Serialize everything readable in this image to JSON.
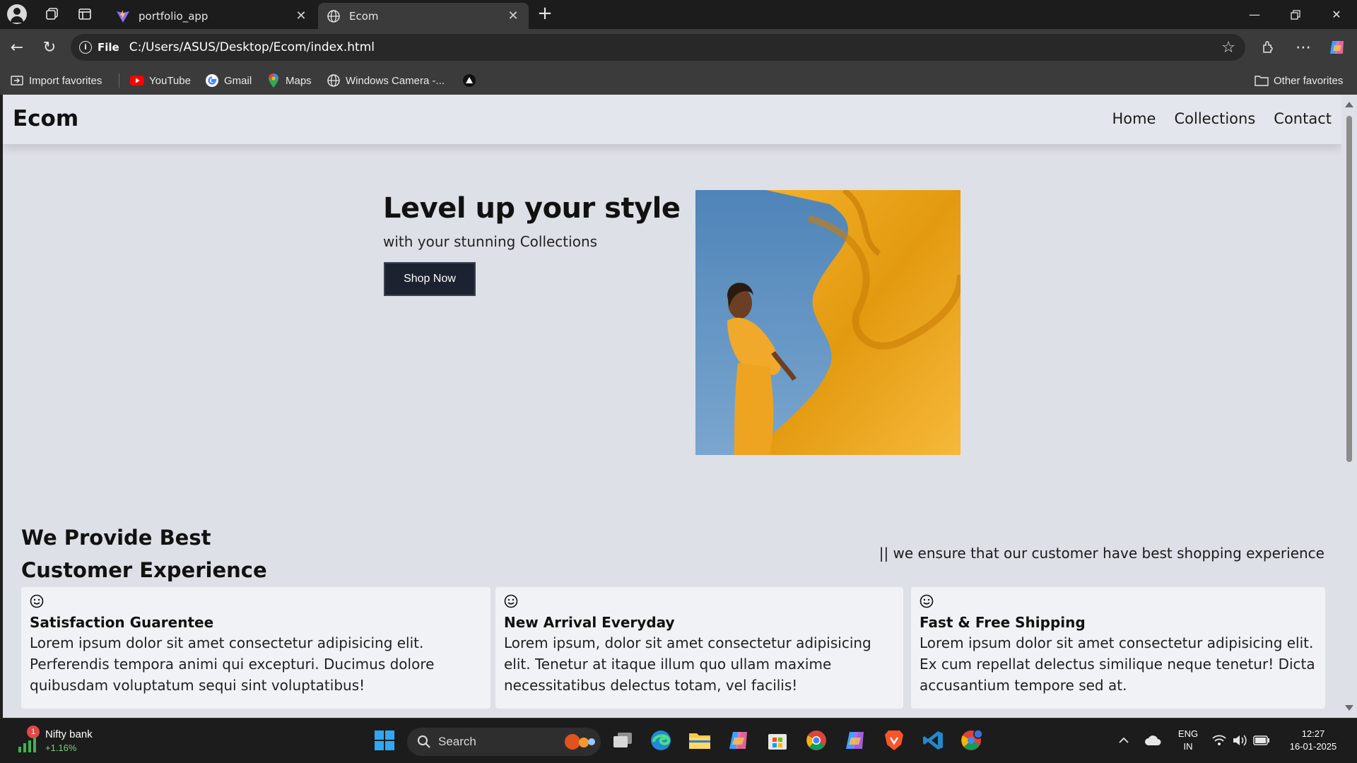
{
  "browser": {
    "tabs": [
      {
        "label": "portfolio_app",
        "icon": "vite-logo-icon"
      },
      {
        "label": "Ecom",
        "icon": "globe-icon"
      }
    ],
    "address": {
      "scheme_tag": "File",
      "url": "C:/Users/ASUS/Desktop/Ecom/index.html"
    },
    "bookmarks": [
      {
        "label": "Import favorites",
        "icon": "import-icon"
      },
      {
        "label": "YouTube",
        "icon": "youtube-icon"
      },
      {
        "label": "Gmail",
        "icon": "google-icon"
      },
      {
        "label": "Maps",
        "icon": "maps-pin-icon"
      },
      {
        "label": "Windows Camera -...",
        "icon": "globe-icon"
      }
    ],
    "other_favorites": "Other favorites"
  },
  "site": {
    "brand": "Ecom",
    "nav": [
      "Home",
      "Collections",
      "Contact"
    ],
    "hero": {
      "title": "Level up your style",
      "subtitle": "with your stunning Collections",
      "cta": "Shop Now"
    },
    "features": {
      "title_line1": "We Provide Best",
      "title_line2": "Customer Experience",
      "tagline": "|| we ensure that our customer have best shopping experience",
      "cards": [
        {
          "title": "Satisfaction Guarentee",
          "body": "Lorem ipsum dolor sit amet consectetur adipisicing elit. Perferendis tempora animi qui excepturi. Ducimus dolore quibusdam voluptatum sequi sint voluptatibus!"
        },
        {
          "title": "New Arrival Everyday",
          "body": "Lorem ipsum, dolor sit amet consectetur adipisicing elit. Tenetur at itaque illum quo ullam maxime necessitatibus delectus totam, vel facilis!"
        },
        {
          "title": "Fast & Free Shipping",
          "body": "Lorem ipsum dolor sit amet consectetur adipisicing elit. Ex cum repellat delectus similique neque tenetur! Dicta accusantium tempore sed at."
        }
      ]
    }
  },
  "taskbar": {
    "stock": {
      "badge": "1",
      "name": "Nifty bank",
      "change": "+1.16%"
    },
    "search_label": "Search",
    "lang": {
      "line1": "ENG",
      "line2": "IN"
    },
    "clock": {
      "time": "12:27",
      "date": "16-01-2025"
    }
  },
  "colors": {
    "page_bg": "#dde0e7",
    "nav_bg": "#e3e6ec",
    "card_bg": "#f1f2f5",
    "button_bg": "#1c2230",
    "chrome_dark": "#1c1c1c",
    "chrome_mid": "#3b3b3b"
  }
}
